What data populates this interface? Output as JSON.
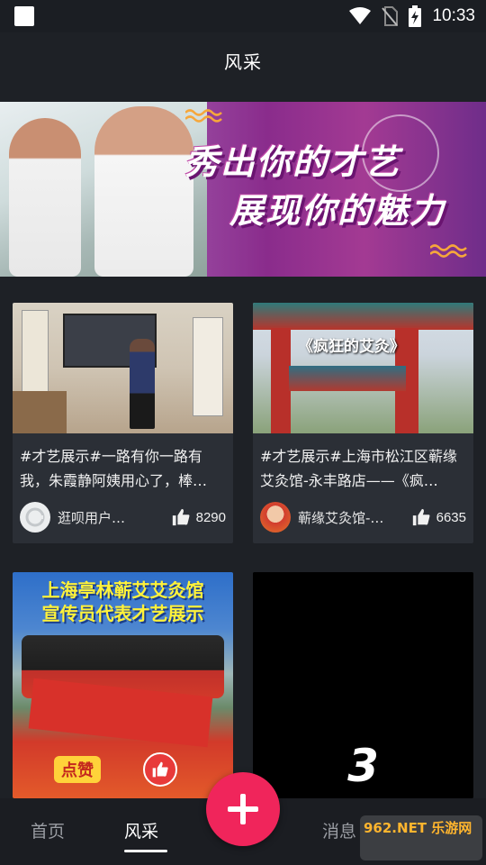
{
  "status_bar": {
    "time": "10:33"
  },
  "header": {
    "title": "风采"
  },
  "banner": {
    "slogan_line1": "秀出你的才艺",
    "slogan_line2": "展现你的魅力"
  },
  "cards": [
    {
      "caption": "#才艺展示#一路有你一路有我，朱霞静阿姨用心了，棒…",
      "author": "逛呗用户…",
      "likes": "8290"
    },
    {
      "caption": "#才艺展示#上海市松江区蕲缘艾灸馆-永丰路店——《疯…",
      "thumb_title": "《疯狂的艾灸》",
      "author": "蕲缘艾灸馆-…",
      "likes": "6635"
    },
    {
      "thumb_title_line1": "上海亭林蕲艾艾灸馆",
      "thumb_title_line2": "宣传员代表才艺展示",
      "thumb_badge": "点赞"
    },
    {
      "thumb_text": "3"
    }
  ],
  "bottom_nav": {
    "home": "首页",
    "moments": "风采",
    "messages": "消息"
  },
  "watermark": "962.NET 乐游网",
  "colors": {
    "accent": "#f0255b",
    "background": "#1e2126",
    "card": "#2b2f36"
  }
}
